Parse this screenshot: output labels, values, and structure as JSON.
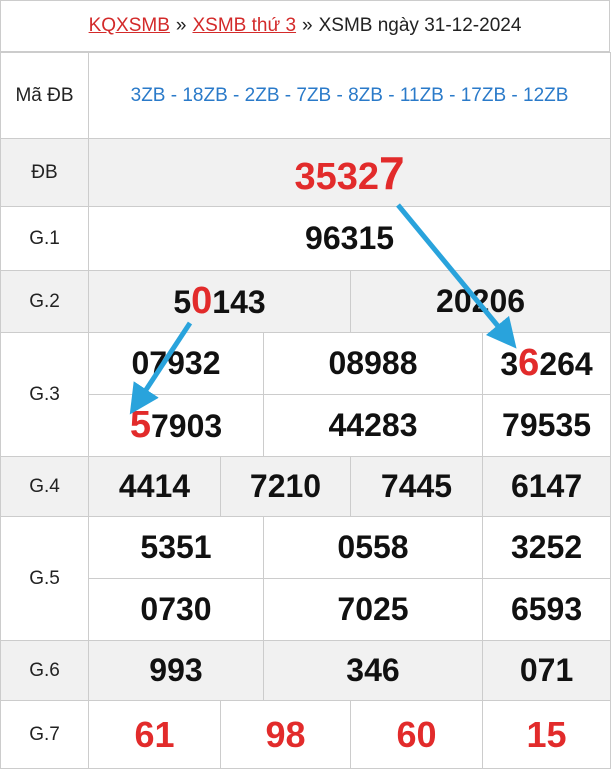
{
  "breadcrumb": {
    "home": "KQXSMB",
    "sep1": "»",
    "weekday_link": "XSMB thứ 3",
    "sep2": "»",
    "current": "XSMB ngày 31-12-2024"
  },
  "labels": {
    "ma_db": "Mã ĐB",
    "db": "ĐB",
    "g1": "G.1",
    "g2": "G.2",
    "g3": "G.3",
    "g4": "G.4",
    "g5": "G.5",
    "g6": "G.6",
    "g7": "G.7"
  },
  "ma_db_codes": "3ZB - 18ZB - 2ZB - 7ZB - 8ZB - 11ZB - 17ZB - 12ZB",
  "db": {
    "prefix": "3532",
    "last": "7"
  },
  "g1": "96315",
  "g2": [
    {
      "a": "5",
      "hl": "0",
      "b": "143"
    },
    {
      "full": "20206"
    }
  ],
  "g3": [
    [
      "07932",
      "08988",
      {
        "a": "3",
        "hl": "6",
        "b": "264"
      }
    ],
    [
      {
        "hl": "5",
        "b": "7903"
      },
      "44283",
      "79535"
    ]
  ],
  "g4": [
    "4414",
    "7210",
    "7445",
    "6147"
  ],
  "g5": [
    [
      "5351",
      "0558",
      "3252"
    ],
    [
      "0730",
      "7025",
      "6593"
    ]
  ],
  "g6": [
    "993",
    "346",
    "071"
  ],
  "g7": [
    "61",
    "98",
    "60",
    "15"
  ],
  "colors": {
    "arrow": "#29a3dc",
    "highlight": "#e22b2b",
    "code": "#2a7ac9"
  }
}
